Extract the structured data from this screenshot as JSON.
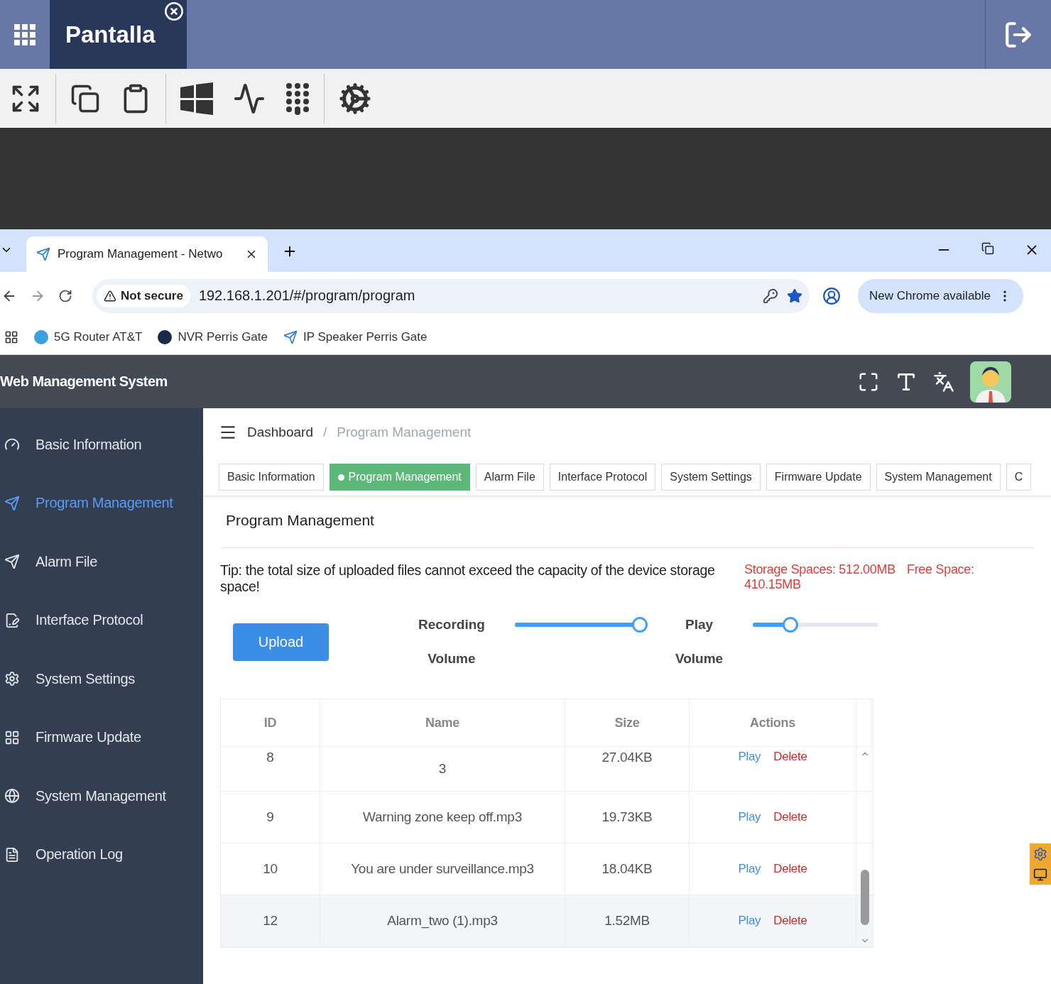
{
  "remote_bar": {
    "tab_title": "Pantalla"
  },
  "browser": {
    "tab_title": "Program Management - Netwo",
    "security": "Not secure",
    "url": "192.168.1.201/#/program/program",
    "update_chip": "New Chrome available",
    "bookmarks": [
      {
        "label": "5G Router AT&T"
      },
      {
        "label": "NVR Perris Gate"
      },
      {
        "label": "IP Speaker Perris Gate"
      }
    ]
  },
  "app": {
    "title": "Web Management System"
  },
  "sidebar": {
    "items": [
      {
        "label": "Basic Information",
        "selected": false
      },
      {
        "label": "Program Management",
        "selected": true
      },
      {
        "label": "Alarm File",
        "selected": false
      },
      {
        "label": "Interface Protocol",
        "selected": false
      },
      {
        "label": "System Settings",
        "selected": false
      },
      {
        "label": "Firmware Update",
        "selected": false
      },
      {
        "label": "System Management",
        "selected": false
      },
      {
        "label": "Operation Log",
        "selected": false
      }
    ]
  },
  "breadcrumb": [
    "Dashboard",
    "Program Management"
  ],
  "breadcrumb_separator": "/",
  "tabs": [
    {
      "label": "Basic Information",
      "selected": false
    },
    {
      "label": "Program Management",
      "selected": true
    },
    {
      "label": "Alarm File",
      "selected": false
    },
    {
      "label": "Interface Protocol",
      "selected": false
    },
    {
      "label": "System Settings",
      "selected": false
    },
    {
      "label": "Firmware Update",
      "selected": false
    },
    {
      "label": "System Management",
      "selected": false
    },
    {
      "label": "C",
      "selected": false
    }
  ],
  "panel": {
    "title": "Program Management",
    "tip": "Tip: the total size of uploaded files cannot exceed the capacity of the device storage space!",
    "storage": "Storage Spaces: 512.00MB",
    "free_space": "Free Space: 410.15MB",
    "upload": "Upload",
    "sliders": [
      {
        "label": "Recording",
        "sublabel": "Volume",
        "level": 1
      },
      {
        "label": "Play",
        "sublabel": "Volume",
        "level": 0.3
      }
    ]
  },
  "table": {
    "columns": [
      "ID",
      "Name",
      "Size",
      "Actions"
    ],
    "rows": [
      {
        "id": "8",
        "name": "3",
        "size": "27.04KB",
        "play": "Play",
        "delete": "Delete",
        "hovered": false
      },
      {
        "id": "9",
        "name": "Warning zone keep off.mp3",
        "size": "19.73KB",
        "play": "Play",
        "delete": "Delete",
        "hovered": false
      },
      {
        "id": "10",
        "name": "You are under surveillance.mp3",
        "size": "18.04KB",
        "play": "Play",
        "delete": "Delete",
        "hovered": false
      },
      {
        "id": "12",
        "name": "Alarm_two (1).mp3",
        "size": "1.52MB",
        "play": "Play",
        "delete": "Delete",
        "hovered": true
      }
    ]
  }
}
